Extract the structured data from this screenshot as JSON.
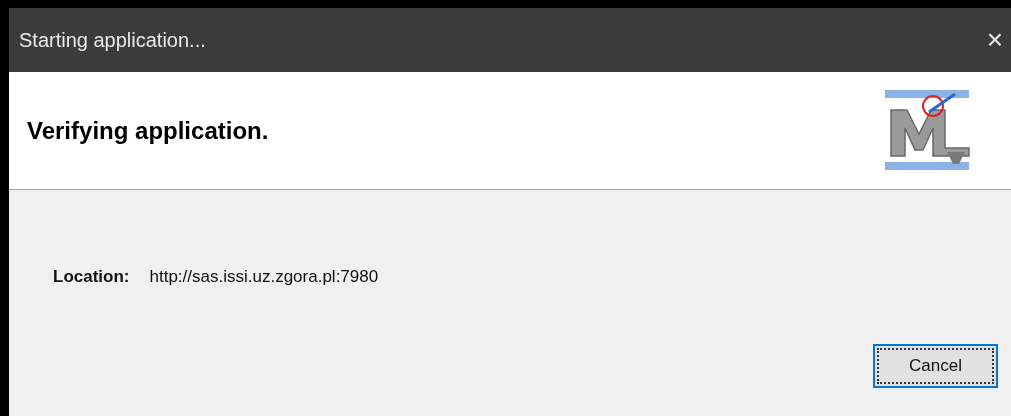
{
  "window": {
    "title": "Starting application...",
    "close": "×"
  },
  "header": {
    "heading": "Verifying application."
  },
  "location": {
    "label": "Location:",
    "value": "http://sas.issi.uz.zgora.pl:7980"
  },
  "buttons": [
    {
      "label": "Cancel",
      "focused": true
    }
  ]
}
